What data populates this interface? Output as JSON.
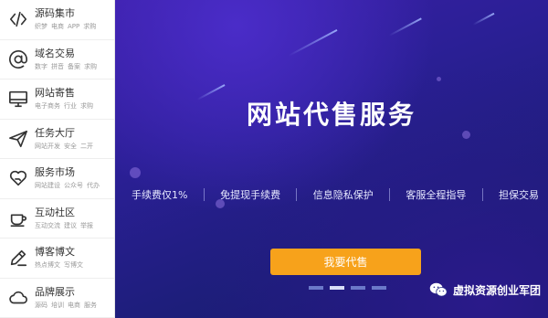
{
  "sidebar": {
    "items": [
      {
        "icon": "code-icon",
        "title": "源码集市",
        "tags": [
          "织梦",
          "电商",
          "APP",
          "求购"
        ]
      },
      {
        "icon": "at-icon",
        "title": "域名交易",
        "tags": [
          "数字",
          "拼音",
          "备案",
          "求购"
        ]
      },
      {
        "icon": "monitor-icon",
        "title": "网站寄售",
        "tags": [
          "电子商务",
          "行业",
          "求购"
        ]
      },
      {
        "icon": "paper-plane-icon",
        "title": "任务大厅",
        "tags": [
          "网站开发",
          "安全",
          "二开"
        ]
      },
      {
        "icon": "heart-hand-icon",
        "title": "服务市场",
        "tags": [
          "网站建设",
          "公众号",
          "代办"
        ]
      },
      {
        "icon": "cup-icon",
        "title": "互动社区",
        "tags": [
          "互动交流",
          "建议",
          "举报"
        ]
      },
      {
        "icon": "pen-icon",
        "title": "博客博文",
        "tags": [
          "热点博文",
          "写博文"
        ]
      },
      {
        "icon": "cloud-icon",
        "title": "品牌展示",
        "tags": [
          "源码",
          "培训",
          "电商",
          "服务"
        ]
      }
    ]
  },
  "banner": {
    "headline": "网站代售服务",
    "features": [
      "手续费仅1%",
      "免提现手续费",
      "信息隐私保护",
      "客服全程指导",
      "担保交易"
    ],
    "cta_label": "我要代售",
    "pager": {
      "count": 4,
      "active_index": 1
    },
    "watermark": "虚拟资源创业军团"
  },
  "colors": {
    "accent": "#f7a21b",
    "banner_dark": "#16186a",
    "banner_purple": "#3c1fa8"
  }
}
